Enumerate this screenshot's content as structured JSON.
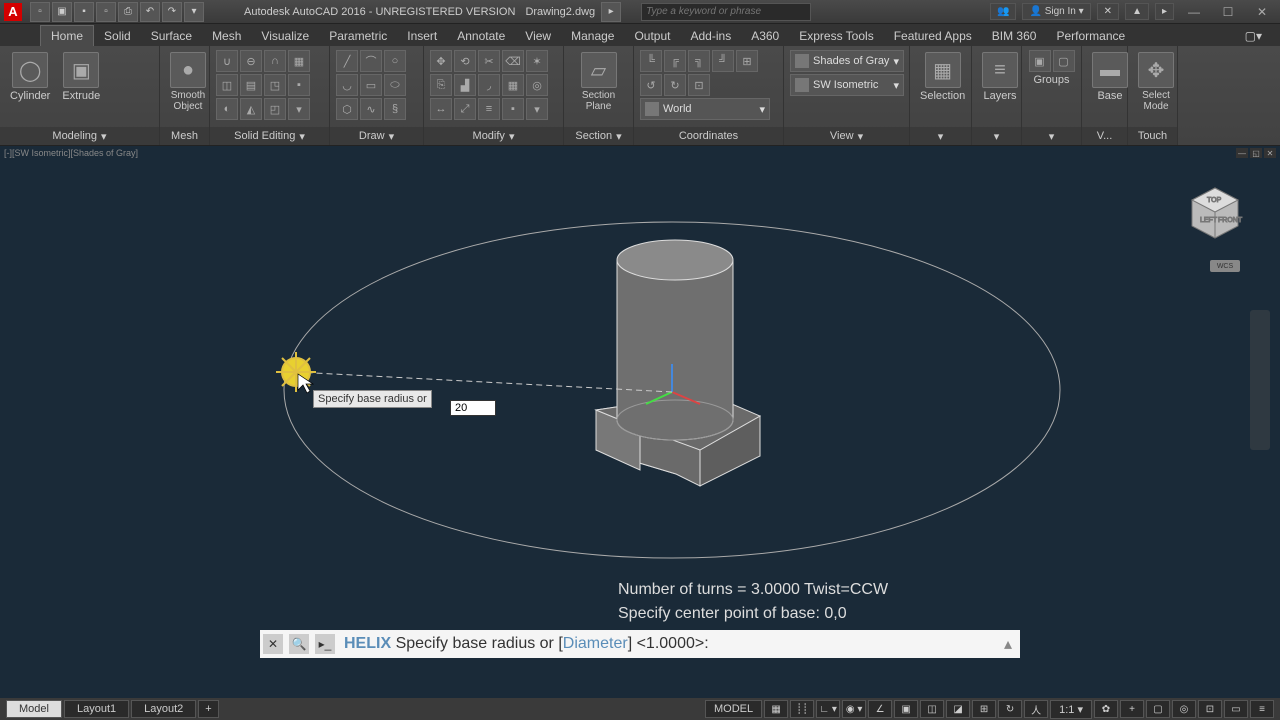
{
  "title": {
    "app": "Autodesk AutoCAD 2016 - UNREGISTERED VERSION",
    "file": "Drawing2.dwg",
    "search_placeholder": "Type a keyword or phrase",
    "signin": "Sign In"
  },
  "ribbon_tabs": [
    "Home",
    "Solid",
    "Surface",
    "Mesh",
    "Visualize",
    "Parametric",
    "Insert",
    "Annotate",
    "View",
    "Manage",
    "Output",
    "Add-ins",
    "A360",
    "Express Tools",
    "Featured Apps",
    "BIM 360",
    "Performance"
  ],
  "active_tab": "Home",
  "panels": {
    "modeling": {
      "label": "Modeling",
      "btn1": "Cylinder",
      "btn2": "Extrude",
      "btn3": "Smooth Object"
    },
    "mesh": {
      "label": "Mesh"
    },
    "solid_editing": {
      "label": "Solid Editing"
    },
    "draw": {
      "label": "Draw"
    },
    "modify": {
      "label": "Modify"
    },
    "section": {
      "label": "Section",
      "btn": "Section Plane"
    },
    "coordinates": {
      "label": "Coordinates",
      "world": "World"
    },
    "view": {
      "label": "View",
      "shades": "Shades of Gray",
      "iso": "SW Isometric"
    },
    "selection": {
      "label": "Selection"
    },
    "layers": {
      "label": "Layers"
    },
    "groups": {
      "label": "Groups"
    },
    "base": {
      "label": "V...",
      "btn": "Base"
    },
    "touch": {
      "label": "Touch",
      "btn": "Select Mode"
    }
  },
  "viewport": {
    "label": "[-][SW Isometric][Shades of Gray]",
    "wcs": "WCS"
  },
  "dynamic": {
    "prompt": "Specify base radius or",
    "value": "20"
  },
  "history": {
    "line1": "Number of turns = 3.0000    Twist=CCW",
    "line2": "Specify center point of base: 0,0"
  },
  "command": {
    "name": "HELIX",
    "prompt": "Specify base radius or [",
    "opt": "Diameter",
    "tail": "] <1.0000>:"
  },
  "bottom_tabs": [
    "Model",
    "Layout1",
    "Layout2"
  ],
  "status": {
    "space": "MODEL",
    "scale": "1:1"
  }
}
